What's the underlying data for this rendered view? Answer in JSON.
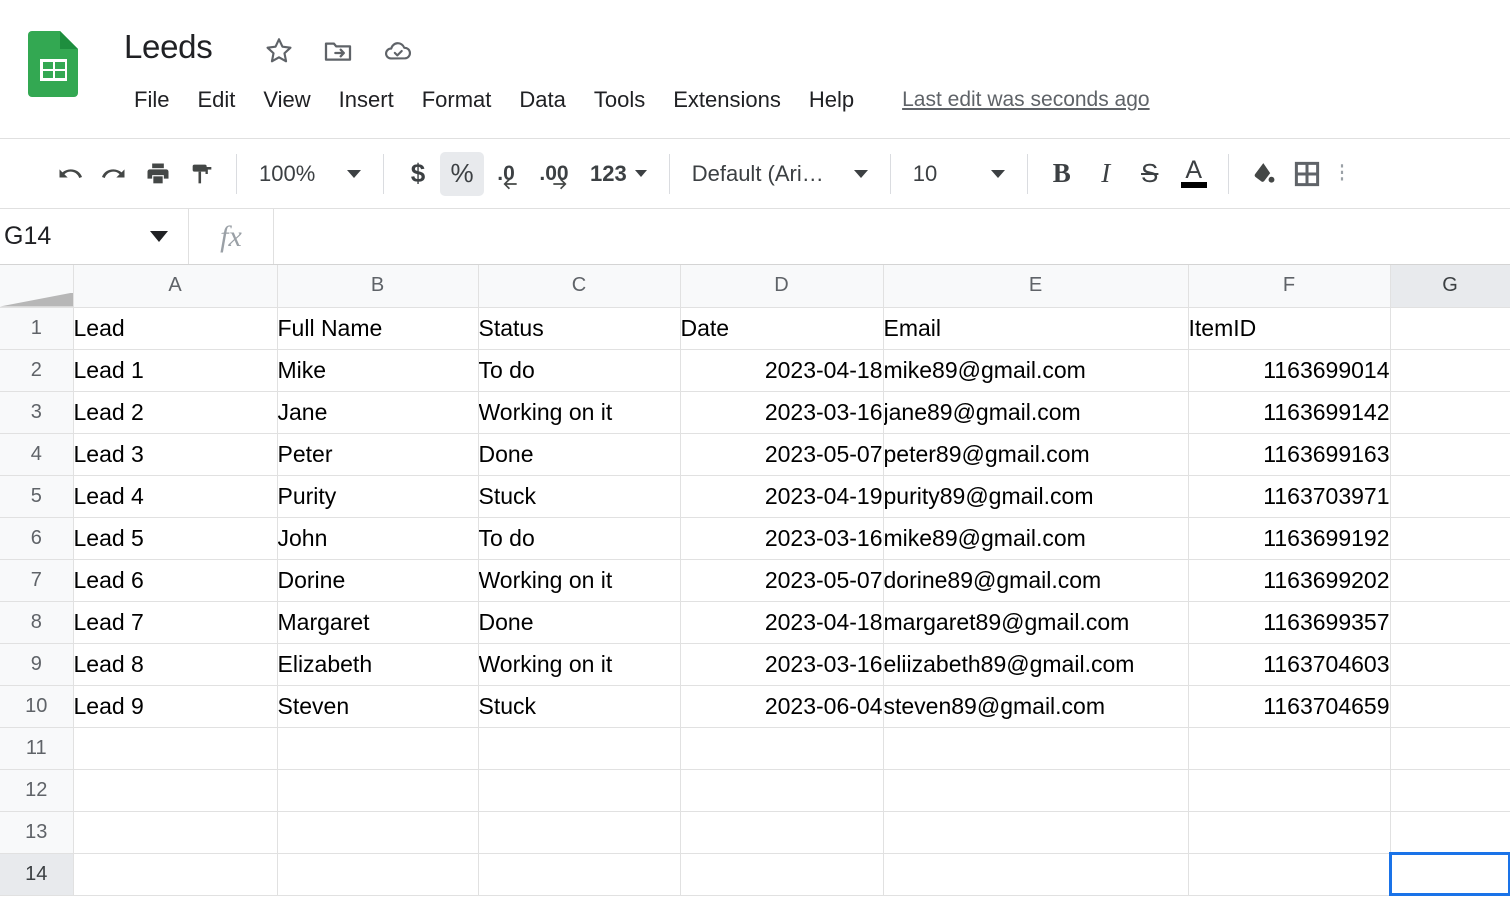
{
  "app": {
    "name": "Google Sheets",
    "logo_icon": "sheets-logo-icon",
    "brand_green": "#33A852",
    "accent_blue": "#1A73E8"
  },
  "titlebar": {
    "doc_title": "Leeds",
    "icons": [
      {
        "name": "star-icon",
        "label": "Star"
      },
      {
        "name": "move-to-folder-icon",
        "label": "Move"
      },
      {
        "name": "cloud-saved-icon",
        "label": "Saved to Drive"
      }
    ],
    "menus": [
      "File",
      "Edit",
      "View",
      "Insert",
      "Format",
      "Data",
      "Tools",
      "Extensions",
      "Help"
    ],
    "last_edit": "Last edit was seconds ago"
  },
  "toolbar": {
    "undo": "undo-icon",
    "redo": "redo-icon",
    "print": "print-icon",
    "paint_format": "paint-format-icon",
    "zoom_value": "100%",
    "currency": "$",
    "percent": "%",
    "percent_active": true,
    "decrease_decimal": ".0",
    "increase_decimal": ".00",
    "more_formats": "123",
    "font_name": "Default (Ari…",
    "font_size": "10",
    "bold": "B",
    "italic": "I",
    "strikethrough": "S",
    "text_color": "A",
    "text_color_swatch": "#000000",
    "fill_color": "fill-color-icon",
    "borders": "borders-icon",
    "merge": "merge-cells-icon"
  },
  "formulabar": {
    "name_box": "G14",
    "fx_label": "fx",
    "formula_value": "",
    "formula_placeholder": ""
  },
  "grid": {
    "columns": [
      "A",
      "B",
      "C",
      "D",
      "E",
      "F",
      "G"
    ],
    "selected_column": "G",
    "selected_row": "14",
    "selected_cell": "G14",
    "row_numbers": [
      "1",
      "2",
      "3",
      "4",
      "5",
      "6",
      "7",
      "8",
      "9",
      "10",
      "11",
      "12",
      "13",
      "14"
    ],
    "headers": [
      "Lead",
      "Full Name",
      "Status",
      "Date",
      "Email",
      "ItemID",
      ""
    ],
    "rows": [
      [
        "Lead 1",
        "Mike",
        "To do",
        "2023-04-18",
        "mike89@gmail.com",
        "1163699014",
        ""
      ],
      [
        "Lead 2",
        "Jane",
        "Working on it",
        "2023-03-16",
        "jane89@gmail.com",
        "1163699142",
        ""
      ],
      [
        "Lead 3",
        "Peter",
        "Done",
        "2023-05-07",
        "peter89@gmail.com",
        "1163699163",
        ""
      ],
      [
        "Lead 4",
        "Purity",
        "Stuck",
        "2023-04-19",
        "purity89@gmail.com",
        "1163703971",
        ""
      ],
      [
        "Lead 5",
        "John",
        "To do",
        "2023-03-16",
        "mike89@gmail.com",
        "1163699192",
        ""
      ],
      [
        "Lead 6",
        "Dorine",
        "Working on it",
        "2023-05-07",
        "dorine89@gmail.com",
        "1163699202",
        ""
      ],
      [
        "Lead 7",
        "Margaret",
        "Done",
        "2023-04-18",
        "margaret89@gmail.com",
        "1163699357",
        ""
      ],
      [
        "Lead 8",
        "Elizabeth",
        "Working on it",
        "2023-03-16",
        "eliizabeth89@gmail.com",
        "1163704603",
        ""
      ],
      [
        "Lead 9",
        "Steven",
        "Stuck",
        "2023-06-04",
        "steven89@gmail.com",
        "1163704659",
        ""
      ],
      [
        "",
        "",
        "",
        "",
        "",
        "",
        ""
      ],
      [
        "",
        "",
        "",
        "",
        "",
        "",
        ""
      ],
      [
        "",
        "",
        "",
        "",
        "",
        "",
        ""
      ],
      [
        "",
        "",
        "",
        "",
        "",
        "",
        ""
      ]
    ]
  }
}
